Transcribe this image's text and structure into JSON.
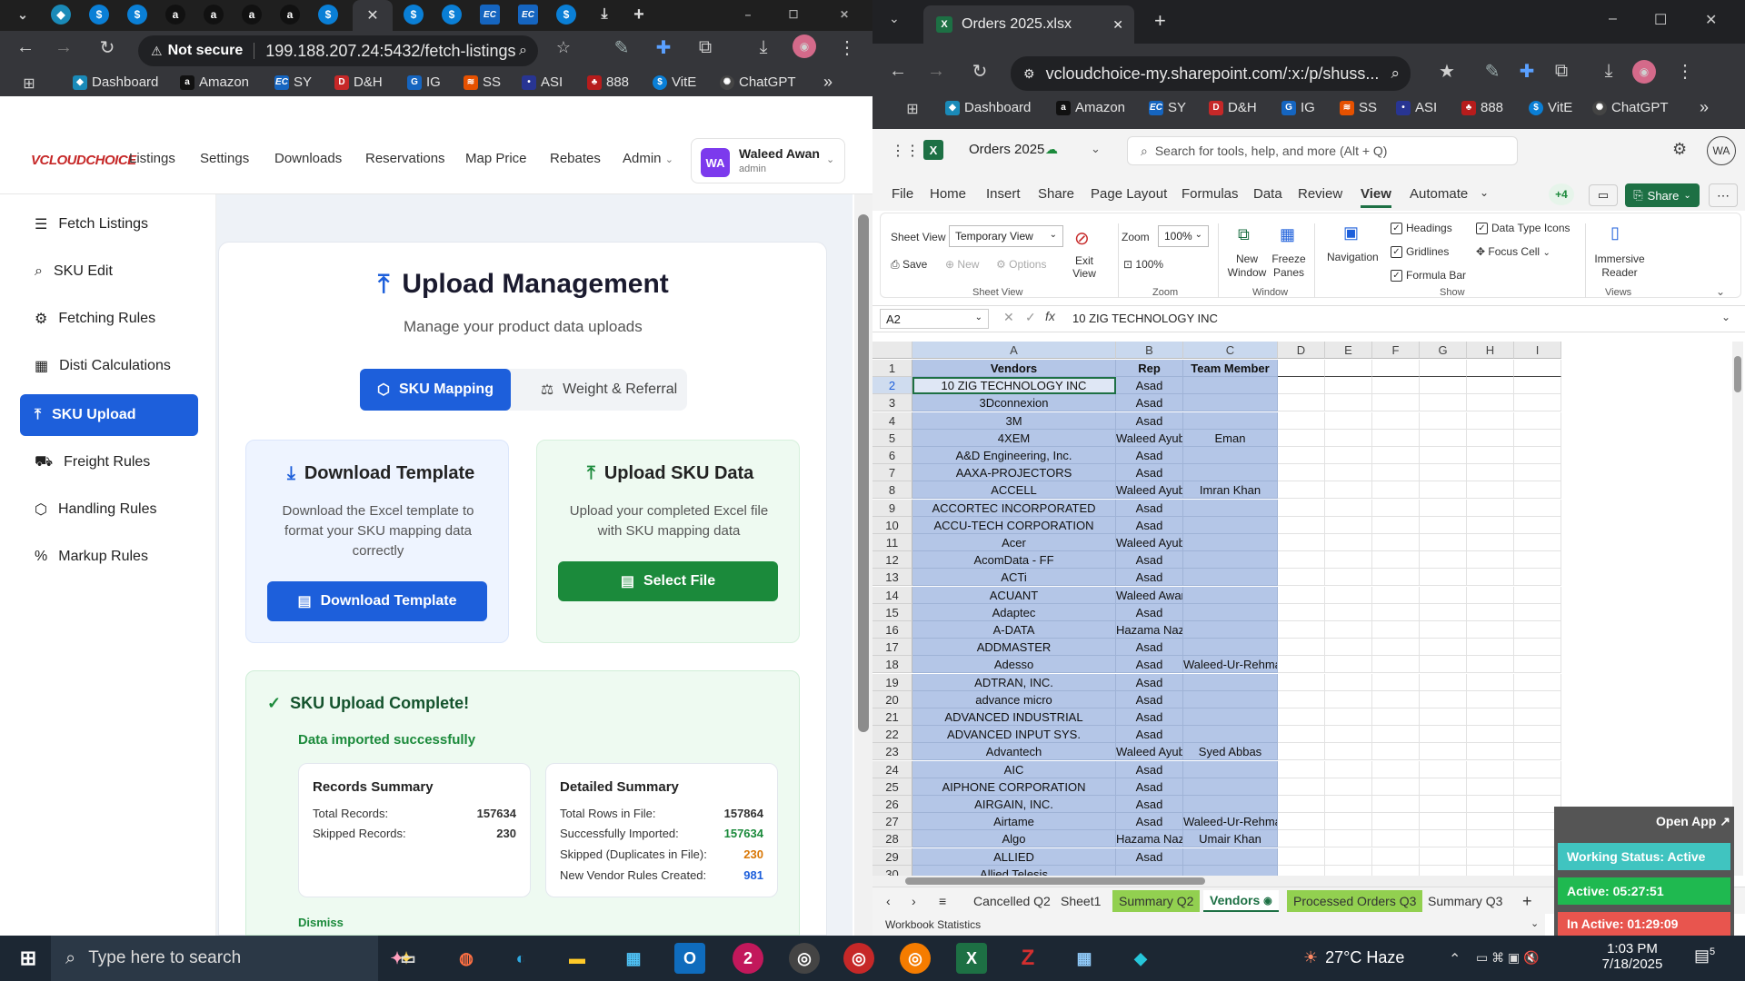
{
  "left_browser": {
    "url_warning": "Not secure",
    "url": "199.188.207.24:5432/fetch-listings",
    "bookmarks": [
      "Dashboard",
      "Amazon",
      "SY",
      "D&H",
      "IG",
      "SS",
      "ASI",
      "888",
      "VitE",
      "ChatGPT"
    ],
    "bookmark_more": "»"
  },
  "app": {
    "logo": "VCLOUDCHOICE",
    "nav": [
      "Listings",
      "Settings",
      "Downloads",
      "Reservations",
      "Map Price",
      "Rebates",
      "Admin"
    ],
    "user_initials": "WA",
    "user_name": "Waleed Awan",
    "user_role": "admin",
    "sidebar": [
      "Fetch Listings",
      "SKU Edit",
      "Fetching Rules",
      "Disti Calculations",
      "SKU Upload",
      "Freight Rules",
      "Handling Rules",
      "Markup Rules"
    ],
    "title": "Upload Management",
    "subtitle": "Manage your product data uploads",
    "tabs": [
      "SKU Mapping",
      "Weight & Referral"
    ],
    "download_title": "Download Template",
    "download_desc": "Download the Excel template to format your SKU mapping data correctly",
    "download_btn": "Download Template",
    "upload_title": "Upload SKU Data",
    "upload_desc": "Upload your completed Excel file with SKU mapping data",
    "upload_btn": "Select File",
    "complete_title": "SKU Upload Complete!",
    "complete_sub": "Data imported successfully",
    "records_summary": {
      "title": "Records Summary",
      "rows": [
        [
          "Total Records:",
          "157634"
        ],
        [
          "Skipped Records:",
          "230"
        ]
      ]
    },
    "detailed_summary": {
      "title": "Detailed Summary",
      "rows": [
        [
          "Total Rows in File:",
          "157864"
        ],
        [
          "Successfully Imported:",
          "157634"
        ],
        [
          "Skipped (Duplicates in File):",
          "230"
        ],
        [
          "New Vendor Rules Created:",
          "981"
        ]
      ]
    },
    "dismiss": "Dismiss"
  },
  "right_browser": {
    "tab_title": "Orders 2025.xlsx",
    "url": "vcloudchoice-my.sharepoint.com/:x:/p/shuss...",
    "bookmarks": [
      "Dashboard",
      "Amazon",
      "SY",
      "D&H",
      "IG",
      "SS",
      "ASI",
      "888",
      "VitE",
      "ChatGPT"
    ],
    "bookmark_more": "»"
  },
  "excel": {
    "file_name": "Orders 2025",
    "search_placeholder": "Search for tools, help, and more (Alt + Q)",
    "user_initials": "WA",
    "menu": [
      "File",
      "Home",
      "Insert",
      "Share",
      "Page Layout",
      "Formulas",
      "Data",
      "Review",
      "View",
      "Automate"
    ],
    "menu_more": "+4",
    "share": "Share",
    "ribbon": {
      "sheet_view_label": "Sheet View",
      "sheet_view_value": "Temporary View",
      "exit_view": "Exit View",
      "save": "Save",
      "new": "New",
      "options": "Options",
      "group_sheet": "Sheet View",
      "zoom_label": "Zoom",
      "zoom_value": "100%",
      "zoom_100": "100%",
      "group_zoom": "Zoom",
      "new_window": "New Window",
      "freeze": "Freeze Panes",
      "group_window": "Window",
      "navigation": "Navigation",
      "headings": "Headings",
      "gridlines": "Gridlines",
      "formula_bar": "Formula Bar",
      "data_type_icons": "Data Type Icons",
      "focus_cell": "Focus Cell",
      "group_show": "Show",
      "immersive": "Immersive Reader",
      "group_views": "Views"
    },
    "name_box": "A2",
    "formula": "10 ZIG TECHNOLOGY INC",
    "columns": [
      "A",
      "B",
      "C",
      "D",
      "E",
      "F",
      "G",
      "H",
      "I"
    ],
    "header_row": [
      "Vendors",
      "Rep",
      "Team Member"
    ],
    "rows": [
      [
        "10 ZIG TECHNOLOGY INC",
        "Asad",
        ""
      ],
      [
        "3Dconnexion",
        "Asad",
        ""
      ],
      [
        "3M",
        "Asad",
        ""
      ],
      [
        "4XEM",
        "Waleed Ayub",
        "Eman"
      ],
      [
        "A&D Engineering, Inc.",
        "Asad",
        ""
      ],
      [
        "AAXA-PROJECTORS",
        "Asad",
        ""
      ],
      [
        "ACCELL",
        "Waleed Ayub",
        "Imran Khan"
      ],
      [
        "ACCORTEC INCORPORATED",
        "Asad",
        ""
      ],
      [
        "ACCU-TECH CORPORATION",
        "Asad",
        ""
      ],
      [
        "Acer",
        "Waleed Ayub",
        ""
      ],
      [
        "AcomData - FF",
        "Asad",
        ""
      ],
      [
        "ACTi",
        "Asad",
        ""
      ],
      [
        "ACUANT",
        "Waleed Awan",
        ""
      ],
      [
        "Adaptec",
        "Asad",
        ""
      ],
      [
        "A-DATA",
        "Hazama Nazir",
        ""
      ],
      [
        "ADDMASTER",
        "Asad",
        ""
      ],
      [
        "Adesso",
        "Asad",
        "Waleed-Ur-Rehman"
      ],
      [
        "ADTRAN, INC.",
        "Asad",
        ""
      ],
      [
        "advance micro",
        "Asad",
        ""
      ],
      [
        "ADVANCED INDUSTRIAL",
        "Asad",
        ""
      ],
      [
        "ADVANCED INPUT SYS.",
        "Asad",
        ""
      ],
      [
        "Advantech",
        "Waleed Ayub",
        "Syed Abbas"
      ],
      [
        "AIC",
        "Asad",
        ""
      ],
      [
        "AIPHONE CORPORATION",
        "Asad",
        ""
      ],
      [
        "AIRGAIN, INC.",
        "Asad",
        ""
      ],
      [
        "Airtame",
        "Asad",
        "Waleed-Ur-Rehman"
      ],
      [
        "Algo",
        "Hazama Nazir",
        "Umair Khan"
      ],
      [
        "ALLIED",
        "Asad",
        ""
      ],
      [
        "Allied Telesis",
        "",
        ""
      ]
    ],
    "sheet_tabs": [
      "Cancelled Q2",
      "Sheet1",
      "Summary Q2",
      "Vendors",
      "Processed Orders Q3",
      "Summary Q3"
    ],
    "status": "Workbook Statistics"
  },
  "overlay": {
    "open_app": "Open App ↗",
    "working_status": "Working Status: Active",
    "active": "Active: 05:27:51",
    "inactive": "In Active: 01:29:09"
  },
  "taskbar": {
    "search_placeholder": "Type here to search",
    "weather": "27°C  Haze",
    "time": "1:03 PM",
    "date": "7/18/2025",
    "notifications": "5",
    "badge_count": "2"
  }
}
